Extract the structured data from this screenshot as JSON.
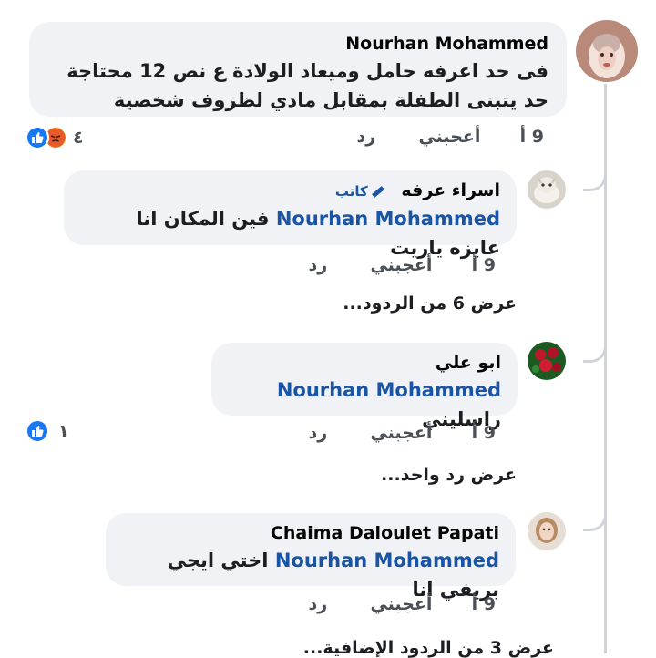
{
  "comments": [
    {
      "author": "Nourhan Mohammed",
      "text": "فى حد اعرفه حامل وميعاد الولادة ع نص 12 محتاجة حد يتبنى الطفلة بمقابل مادي لظروف شخصية",
      "time": "9 أ",
      "like_label": "أعجبني",
      "reply_label": "رد",
      "reaction_count": "٤"
    },
    {
      "author": "اسراء عرفه",
      "badge": "كاتب",
      "mention": "Nourhan Mohammed",
      "text": "فين المكان انا عايزه ياريت",
      "time": "9 أ",
      "like_label": "أعجبني",
      "reply_label": "رد",
      "more_replies": "عرض 6 من الردود..."
    },
    {
      "author": "ابو علي",
      "mention": "Nourhan Mohammed",
      "text": "راسليني",
      "time": "9 أ",
      "like_label": "أعجبني",
      "reply_label": "رد",
      "reaction_count": "١",
      "more_replies": "عرض رد واحد..."
    },
    {
      "author": "Chaima Daloulet Papati",
      "mention": "Nourhan Mohammed",
      "text": "اختي ايجي بريفي انا",
      "time": "9 أ",
      "like_label": "أعجبني",
      "reply_label": "رد",
      "more_replies": "عرض 3 من الردود الإضافية..."
    }
  ],
  "colors": {
    "bubble": "#f0f2f5",
    "mention": "#1a54a4",
    "like_blue": "#1877f2",
    "angry": "#e9710f"
  }
}
